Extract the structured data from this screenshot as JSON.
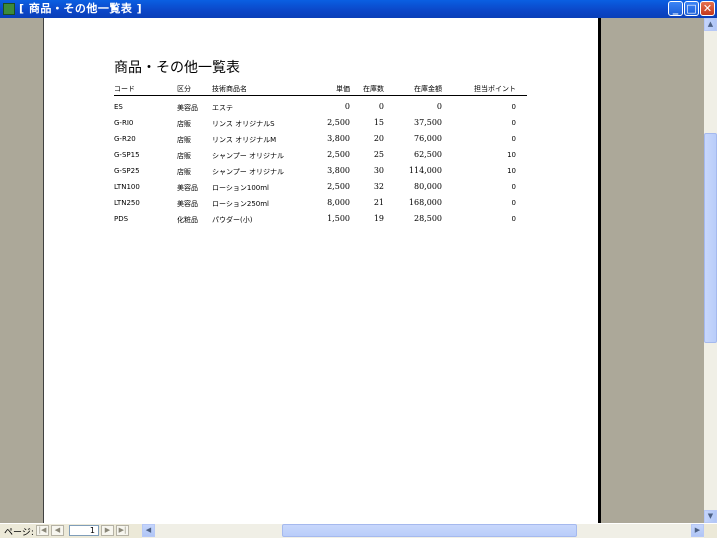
{
  "window": {
    "title": "[ 商品・その他一覧表 ]",
    "min_label": "_",
    "max_label": "□",
    "close_label": "✕"
  },
  "report": {
    "title": "商品・その他一覧表",
    "headers": {
      "code": "コード",
      "kubun": "区分",
      "name": "技術商品名",
      "price": "単価",
      "stock": "在庫数",
      "amount": "在庫金額",
      "point": "担当ポイント"
    },
    "rows": [
      {
        "code": "ES",
        "kubun": "美容品",
        "name": "エステ",
        "price": "0",
        "stock": "0",
        "amount": "0",
        "point": "0"
      },
      {
        "code": "G-RI0",
        "kubun": "店販",
        "name": "リンス オリジナルS",
        "price": "2,500",
        "stock": "15",
        "amount": "37,500",
        "point": "0"
      },
      {
        "code": "G-R20",
        "kubun": "店販",
        "name": "リンス オリジナルM",
        "price": "3,800",
        "stock": "20",
        "amount": "76,000",
        "point": "0"
      },
      {
        "code": "G-SP15",
        "kubun": "店販",
        "name": "シャンプー オリジナル",
        "price": "2,500",
        "stock": "25",
        "amount": "62,500",
        "point": "10"
      },
      {
        "code": "G-SP25",
        "kubun": "店販",
        "name": "シャンプー オリジナル",
        "price": "3,800",
        "stock": "30",
        "amount": "114,000",
        "point": "10"
      },
      {
        "code": "LTN100",
        "kubun": "美容品",
        "name": "ローション100ml",
        "price": "2,500",
        "stock": "32",
        "amount": "80,000",
        "point": "0"
      },
      {
        "code": "LTN250",
        "kubun": "美容品",
        "name": "ローション250ml",
        "price": "8,000",
        "stock": "21",
        "amount": "168,000",
        "point": "0"
      },
      {
        "code": "PDS",
        "kubun": "化粧品",
        "name": "パウダー(小)",
        "price": "1,500",
        "stock": "19",
        "amount": "28,500",
        "point": "0"
      }
    ]
  },
  "navigation": {
    "page_label": "ページ:",
    "current_page": "1",
    "first_icon": "first-page-icon",
    "prev_icon": "prev-page-icon",
    "next_icon": "next-page-icon",
    "last_icon": "last-page-icon"
  },
  "colors": {
    "titlebar": "#0b46c7",
    "workspace": "#aca899",
    "page": "#ffffff"
  }
}
